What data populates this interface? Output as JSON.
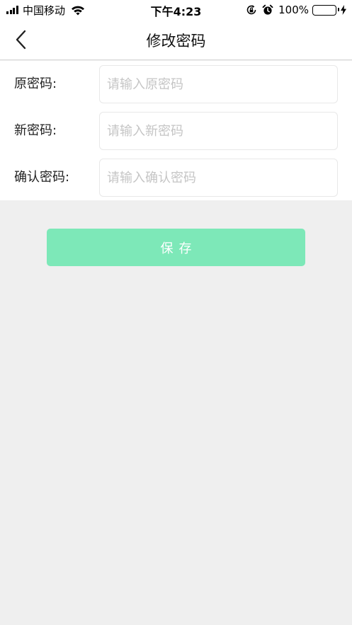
{
  "status_bar": {
    "carrier": "中国移动",
    "time": "下午4:23",
    "battery_percent": "100%",
    "battery_level": 1.0,
    "icons": [
      "signal-icon",
      "wifi-icon",
      "rotation-lock-icon",
      "alarm-icon",
      "battery-icon",
      "charging-icon"
    ]
  },
  "nav": {
    "title": "修改密码",
    "back_icon": "chevron-left-icon"
  },
  "form": {
    "fields": [
      {
        "label": "原密码:",
        "placeholder": "请输入原密码",
        "value": ""
      },
      {
        "label": "新密码:",
        "placeholder": "请输入新密码",
        "value": ""
      },
      {
        "label": "确认密码:",
        "placeholder": "请输入确认密码",
        "value": ""
      }
    ]
  },
  "save_button": {
    "label": "保存",
    "color": "#7de8b8"
  },
  "colors": {
    "background": "#efefef",
    "battery": "#4cd964"
  }
}
